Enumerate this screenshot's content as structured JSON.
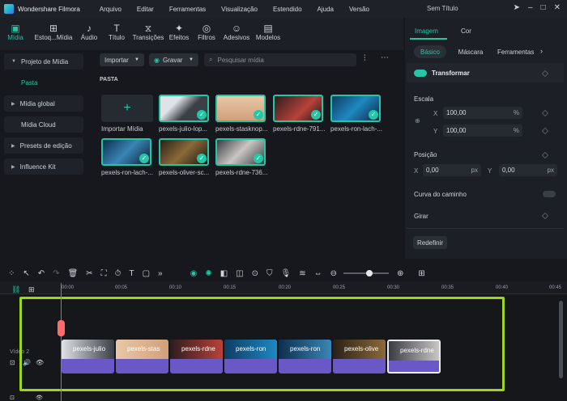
{
  "app": {
    "name": "Wondershare Filmora",
    "window_title": "Sem Título"
  },
  "menu": [
    "Arquivo",
    "Editar",
    "Ferramentas",
    "Visualização",
    "Estendido",
    "Ajuda",
    "Versão"
  ],
  "toolbar": [
    "Mídia",
    "Estoq...Mídia",
    "Áudio",
    "Título",
    "Transições",
    "Efeitos",
    "Filtros",
    "Adesivos",
    "Modelos"
  ],
  "nav": {
    "project": "Projeto de Mídia",
    "pasta": "Pasta",
    "global": "Mídia global",
    "cloud": "Mídia Cloud",
    "presets": "Presets de edição",
    "influence": "Influence Kit"
  },
  "media": {
    "import_btn": "Importar",
    "record_btn": "Gravar",
    "search_placeholder": "Pesquisar mídia",
    "folder_label": "PASTA",
    "import_label": "Importar Mídia",
    "items": [
      "pexels-julio-lop...",
      "pexels-stasknop...",
      "pexels-rdne-791...",
      "pexels-ron-lach-...",
      "pexels-ron-lach-...",
      "pexels-oliver-sc...",
      "pexels-rdne-736..."
    ]
  },
  "props": {
    "tab_image": "Imagem",
    "tab_color": "Cor",
    "sub_basic": "Básico",
    "sub_mask": "Máscara",
    "sub_tools": "Ferramentas",
    "transform": "Transformar",
    "scale": "Escala",
    "x_label": "X",
    "y_label": "Y",
    "scale_x": "100,00",
    "scale_y": "100,00",
    "percent": "%",
    "position": "Posição",
    "pos_x": "0,00",
    "pos_y": "0,00",
    "px": "px",
    "path_curve": "Curva do caminho",
    "rotate": "Girar",
    "reset": "Redefinir"
  },
  "ruler": [
    "00:00",
    "00:05",
    "00:10",
    "00:15",
    "00:20",
    "00:25",
    "00:30",
    "00:35",
    "00:40",
    "00:45"
  ],
  "track": {
    "label": "Vídeo 2"
  },
  "clips": [
    "pexels-julio",
    "pexels-stas",
    "pexels-rdne",
    "pexels-ron",
    "pexels-ron",
    "pexels-olive",
    "pexels-rdne"
  ],
  "colors": {
    "accent": "#25c6a6",
    "highlight": "#9dd61c",
    "clip": "#6a58c7",
    "playhead": "#ff4a4a"
  }
}
